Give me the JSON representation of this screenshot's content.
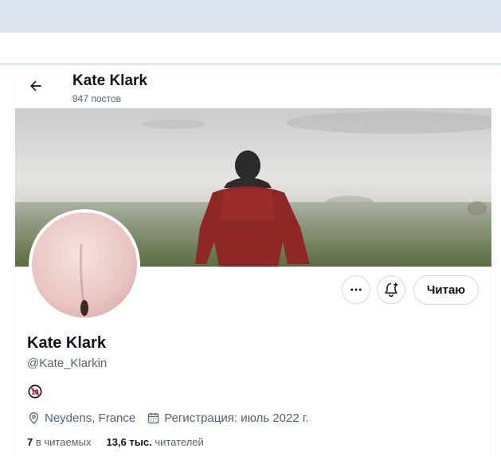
{
  "header": {
    "name": "Kate Klark",
    "posts_count": "947 постов"
  },
  "icons": {
    "back": "arrow-left-icon",
    "more": "more-dots-icon",
    "notify": "bell-plus-icon",
    "location": "location-pin-icon",
    "calendar": "calendar-icon",
    "age": "adults-only-18-icon"
  },
  "actions": {
    "follow_label": "Читаю"
  },
  "profile": {
    "display_name": "Kate Klark",
    "handle": "@Kate_Klarkin",
    "bio_emoji": "🔞",
    "location": "Neydens, France",
    "joined": "Регистрация: июль 2022 г.",
    "following_count": "7",
    "following_label": "в читаемых",
    "followers_count": "13,6 тыс.",
    "followers_label": "читателей"
  },
  "colors": {
    "text": "#0f1419",
    "muted": "#536471",
    "border": "#cfd9de",
    "browser_bar": "#dbe4ee"
  }
}
